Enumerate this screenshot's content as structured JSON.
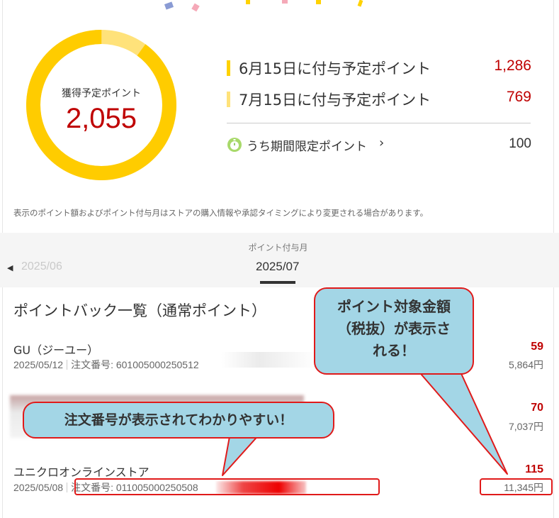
{
  "summary": {
    "total_label": "獲得予定ポイント",
    "total_value": "2,055",
    "donut_progress": 0.9,
    "scheduled": [
      {
        "label": "6月15日に付与予定ポイント",
        "value": "1,286"
      },
      {
        "label": "7月15日に付与予定ポイント",
        "value": "769"
      }
    ],
    "limited_label": "うち期間限定ポイント",
    "limited_value": "100"
  },
  "note": "表示のポイント額およびポイント付与月はストアの購入情報や承認タイミングにより変更される場合があります。",
  "month_selector": {
    "caption": "ポイント付与月",
    "prev_month": "2025/06",
    "current_month": "2025/07"
  },
  "list": {
    "title": "ポイントバック一覧（通常ポイント）",
    "items": [
      {
        "store": "GU（ジーユー）",
        "date": "2025/05/12",
        "order": "注文番号: 601005000250512",
        "points": "59",
        "amount": "5,864円"
      },
      {
        "store": "",
        "date": "",
        "order": "",
        "points": "70",
        "amount": "7,037円"
      },
      {
        "store": "ユニクロオンラインストア",
        "date": "2025/05/08",
        "order": "注文番号: 011005000250508",
        "points": "115",
        "amount": "11,345円"
      }
    ]
  },
  "callouts": {
    "amount_note": [
      "ポイント対象金額",
      "（税抜）が表示さ",
      "れる！"
    ],
    "order_note": "注文番号が表示されてわかりやすい！"
  },
  "colors": {
    "accent_red": "#bf0000",
    "gold": "#ffd200",
    "callout_bg": "#a3d6e6",
    "callout_border": "#e01a1a"
  }
}
